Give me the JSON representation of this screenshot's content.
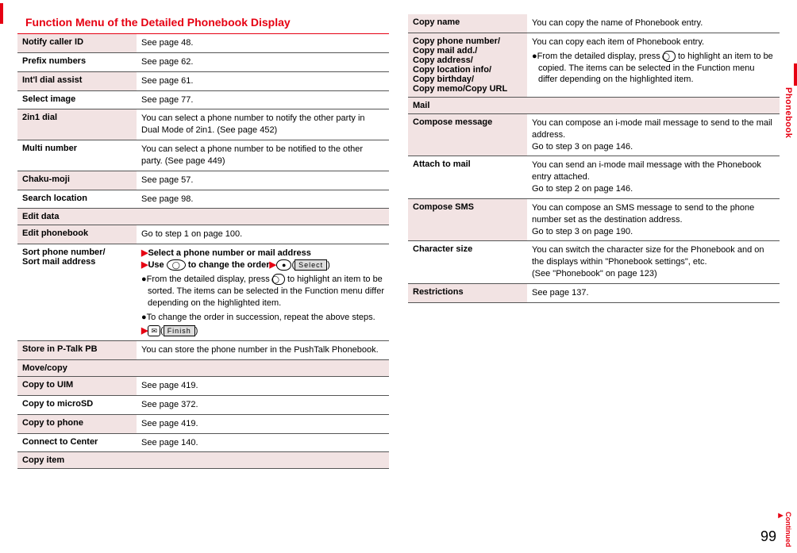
{
  "title": "Function Menu of the Detailed Phonebook Display",
  "sideTab": "Phonebook",
  "pageNum": "99",
  "continued": "Continued",
  "rows": {
    "notifyCallerId": {
      "label": "Notify caller ID",
      "desc": "See page 48."
    },
    "prefixNumbers": {
      "label": "Prefix numbers",
      "desc": "See page 62."
    },
    "intlDialAssist": {
      "label": "Int'l dial assist",
      "desc": "See page 61."
    },
    "selectImage": {
      "label": "Select image",
      "desc": "See page 77."
    },
    "twoInOneDial": {
      "label": "2in1 dial",
      "desc": "You can select a phone number to notify the other party in Dual Mode of 2in1. (See page 452)"
    },
    "multiNumber": {
      "label": "Multi number",
      "desc": "You can select a phone number to be notified to the other party. (See page 449)"
    },
    "chakuMoji": {
      "label": "Chaku-moji",
      "desc": "See page 57."
    },
    "searchLocation": {
      "label": "Search location",
      "desc": "See page 98."
    },
    "editData": {
      "label": "Edit data"
    },
    "editPhonebook": {
      "label": "Edit phonebook",
      "desc": "Go to step 1 on page 100."
    },
    "sortPhone": {
      "label1": "Sort phone number/",
      "label2": "Sort mail address",
      "desc": {
        "line1a": "Select a phone number or mail address",
        "line2a": "Use ",
        "line2b": " to change the order",
        "selectBtn": "Select",
        "bullet1": "From the detailed display, press ",
        "bullet1b": " to highlight an item to be sorted. The items can be selected in the Function menu differ depending on the highlighted item.",
        "bullet2": "To change the order in succession, repeat the above steps.",
        "finishBtn": "Finish"
      }
    },
    "storePTalk": {
      "label": "Store in P-Talk PB",
      "desc": "You can store the phone number in the PushTalk Phonebook."
    },
    "moveCopy": {
      "label": "Move/copy"
    },
    "copyToUim": {
      "label": "Copy to UIM",
      "desc": "See page 419."
    },
    "copyToMicroSD": {
      "label": "Copy to microSD",
      "desc": "See page 372."
    },
    "copyToPhone": {
      "label": "Copy to phone",
      "desc": "See page 419."
    },
    "connectCenter": {
      "label": "Connect to Center",
      "desc": "See page 140."
    },
    "copyItem": {
      "label": "Copy item"
    },
    "copyName": {
      "label": "Copy name",
      "desc": "You can copy the name of Phonebook entry."
    },
    "copyPhone": {
      "l1": "Copy phone number/",
      "l2": "Copy mail add./",
      "l3": "Copy address/",
      "l4": "Copy location info/",
      "l5": "Copy birthday/",
      "l6": "Copy memo/Copy URL",
      "d1": "You can copy each item of Phonebook entry.",
      "d2a": "From the detailed display, press ",
      "d2b": " to highlight an item to be copied. The items can be selected in the Function menu differ depending on the highlighted item."
    },
    "mail": {
      "label": "Mail"
    },
    "composeMsg": {
      "label": "Compose message",
      "desc": "You can compose an i-mode mail message to send to the mail address.\nGo to step 3 on page 146."
    },
    "attachMail": {
      "label": "Attach to mail",
      "desc": "You can send an i-mode mail message with the Phonebook entry attached.\nGo to step 2 on page 146."
    },
    "composeSms": {
      "label": "Compose SMS",
      "desc": "You can compose an SMS message to send to the phone number set as the destination address.\nGo to step 3 on page 190."
    },
    "charSize": {
      "label": "Character size",
      "desc": "You can switch the character size for the Phonebook and on the displays within \"Phonebook settings\", etc.\n(See \"Phonebook\" on page 123)"
    },
    "restrictions": {
      "label": "Restrictions",
      "desc": "See page 137."
    }
  }
}
